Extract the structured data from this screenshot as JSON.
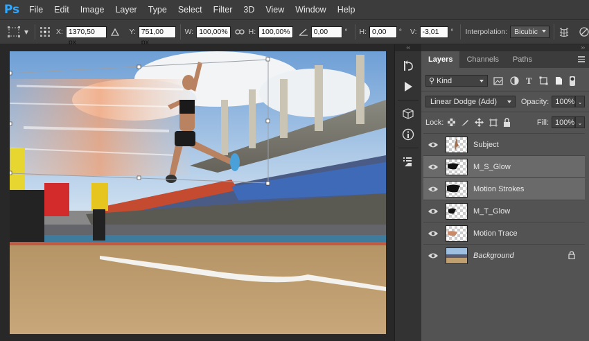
{
  "app": {
    "logo": "Ps"
  },
  "menu": [
    "File",
    "Edit",
    "Image",
    "Layer",
    "Type",
    "Select",
    "Filter",
    "3D",
    "View",
    "Window",
    "Help"
  ],
  "options": {
    "x_label": "X:",
    "x_value": "1370,50 px",
    "y_label": "Y:",
    "y_value": "751,00 px",
    "w_label": "W:",
    "w_value": "100,00%",
    "h_label": "H:",
    "h_value": "100,00%",
    "angle_value": "0,00",
    "hskew_label": "H:",
    "hskew_value": "0,00",
    "vskew_label": "V:",
    "vskew_value": "-3,01",
    "degree_symbol": "°",
    "interp_label": "Interpolation:",
    "interp_value": "Bicubic"
  },
  "layers_panel": {
    "tabs": [
      "Layers",
      "Channels",
      "Paths"
    ],
    "active_tab": "Layers",
    "filter_kind": "Kind",
    "blend_mode": "Linear Dodge (Add)",
    "opacity_label": "Opacity:",
    "opacity_value": "100%",
    "lock_label": "Lock:",
    "fill_label": "Fill:",
    "fill_value": "100%",
    "layers": [
      {
        "name": "Subject",
        "selected": false
      },
      {
        "name": "M_S_Glow",
        "selected": true
      },
      {
        "name": "Motion Strokes",
        "selected": true
      },
      {
        "name": "M_T_Glow",
        "selected": false
      },
      {
        "name": "Motion Trace",
        "selected": false
      },
      {
        "name": "Background",
        "selected": false,
        "locked": true
      }
    ]
  },
  "colors": {
    "accent": "#31a8ff",
    "panel": "#535353",
    "selected_layer": "#6a6a6a"
  }
}
